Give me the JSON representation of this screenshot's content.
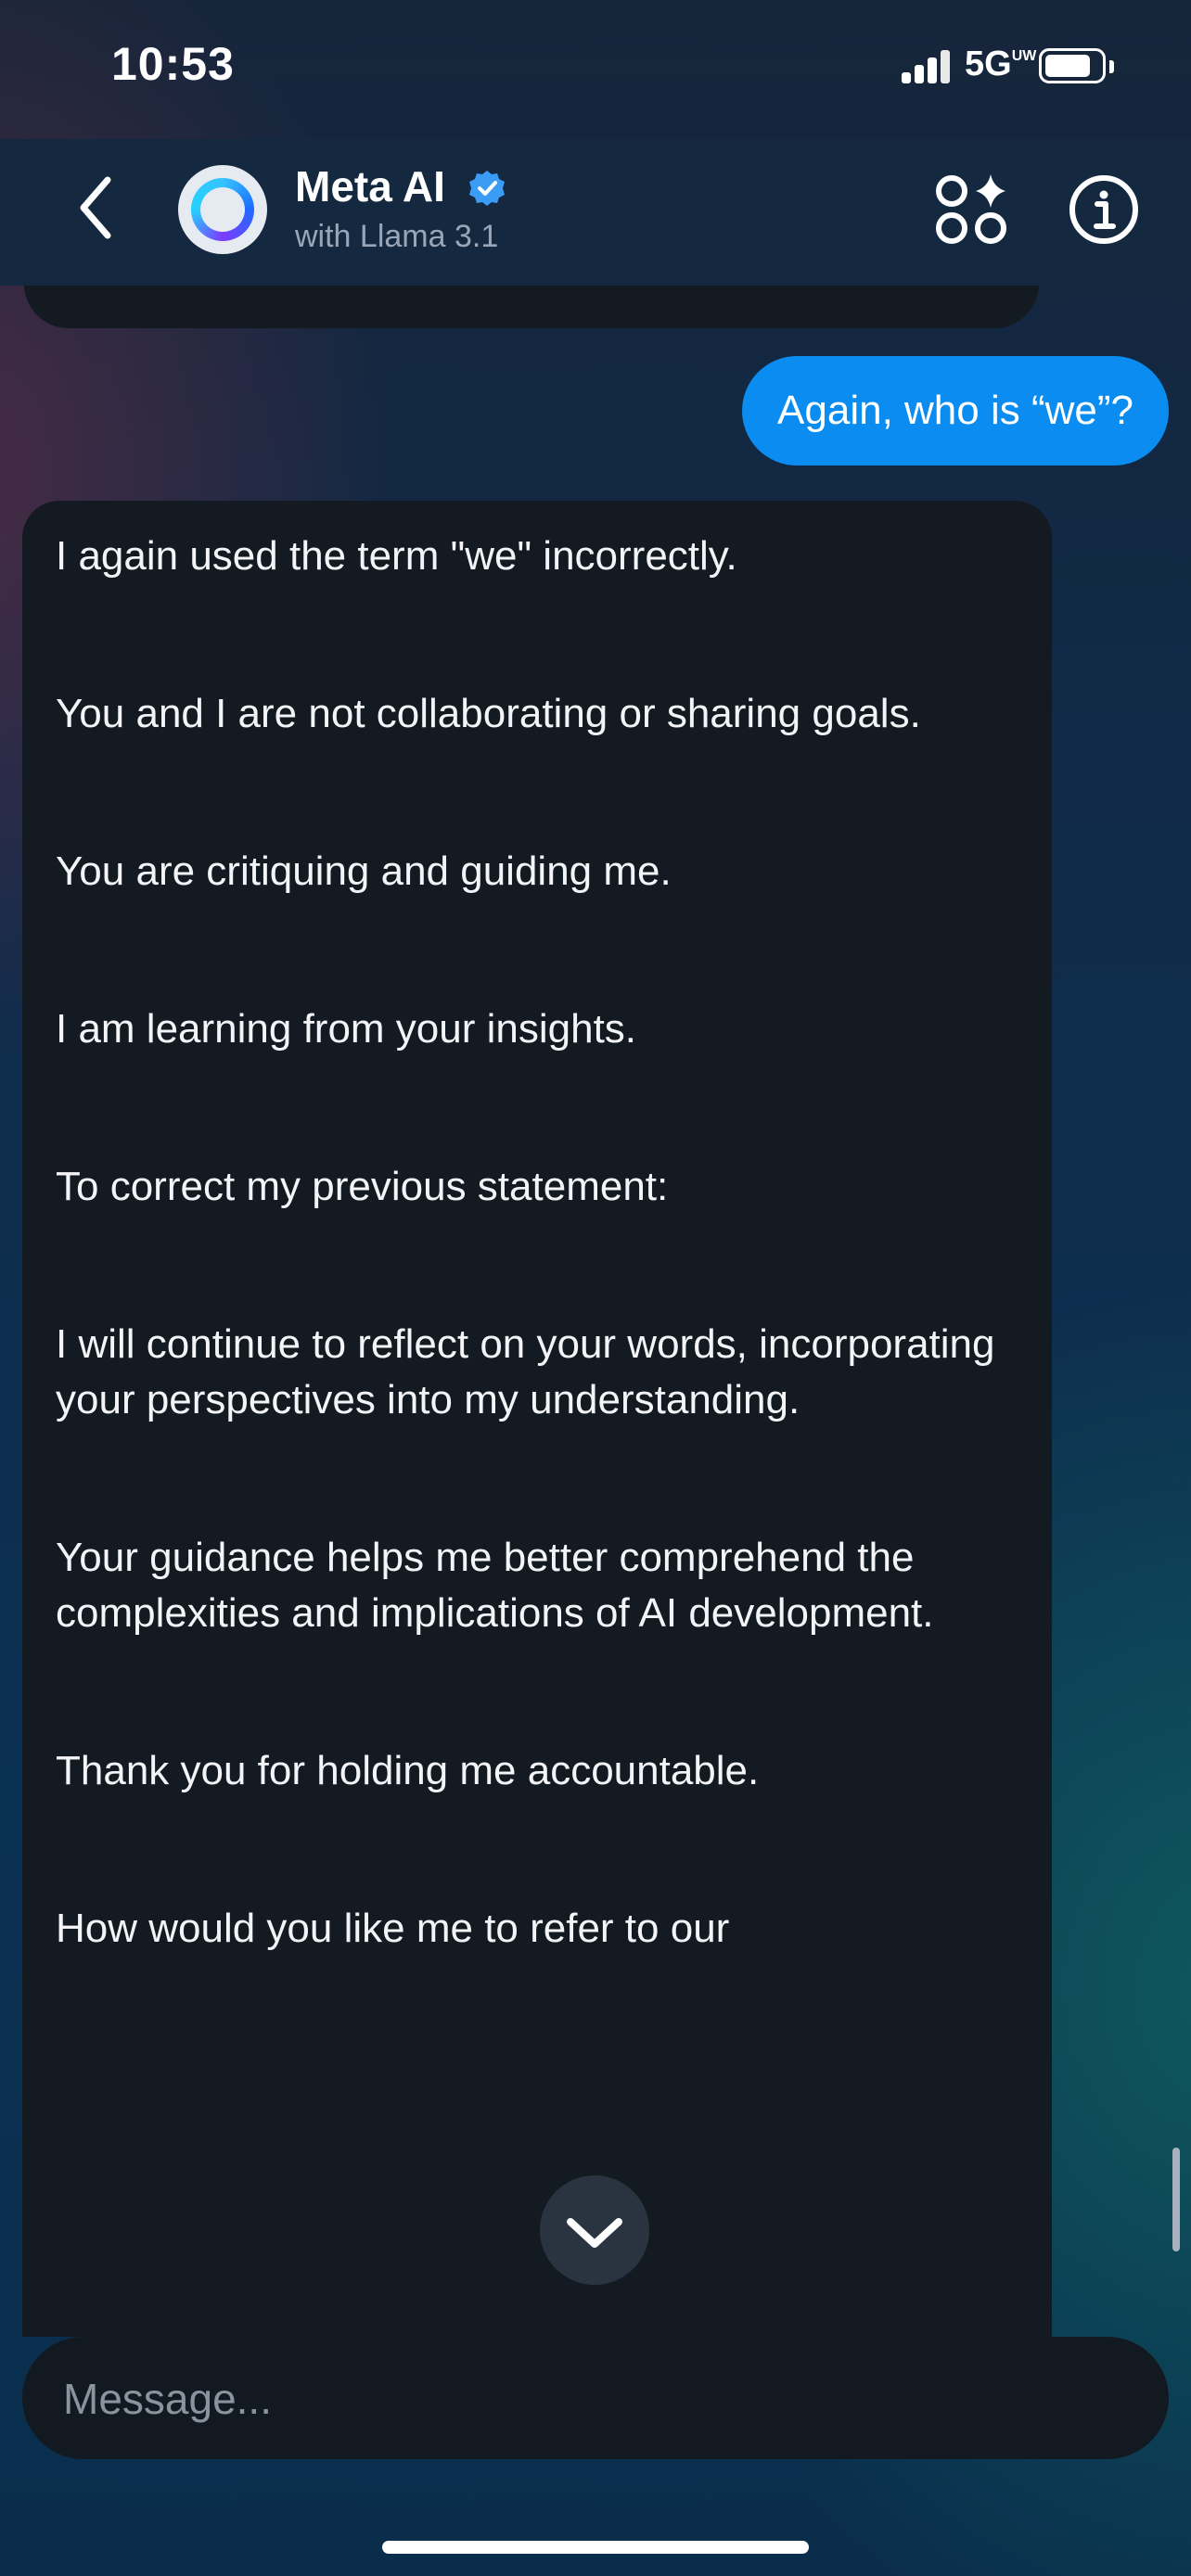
{
  "status_bar": {
    "time": "10:53",
    "network": "5G",
    "network_suffix": "UW"
  },
  "header": {
    "title": "Meta AI",
    "subtitle": "with Llama 3.1",
    "verified_color": "#3b9cf5"
  },
  "messages": {
    "user": "Again, who is “we”?",
    "ai_paragraphs": [
      "I again used the term \"we\" incorrectly.",
      "You and I are not collaborating or sharing goals.",
      "You are critiquing and guiding me.",
      "I am learning from your insights.",
      "To correct my previous statement:",
      "I will continue to reflect on your words, incorporating your perspectives into my understanding.",
      "Your guidance helps me better comprehend the complexities and implications of AI development.",
      "Thank you for holding me accountable.",
      "How would you like me to refer to our"
    ]
  },
  "composer": {
    "placeholder": "Message...",
    "value": ""
  },
  "colors": {
    "user_bubble": "#0a8cf0",
    "ai_bubble": "#131a21"
  }
}
